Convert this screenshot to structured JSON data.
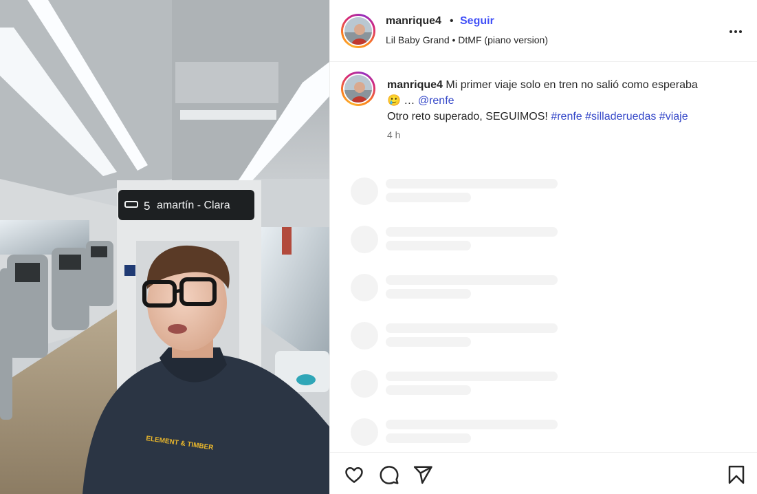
{
  "post": {
    "author": {
      "username": "manrique4",
      "separator": "•",
      "follow_label": "Seguir"
    },
    "audio": {
      "artist": "Lil Baby Grand",
      "separator": "•",
      "track": "DtMF (piano version)"
    },
    "media": {
      "train_sign_number": "5",
      "train_sign_text": "amartín - Clara",
      "hoodie_print": "ELEMENT & TIMBER"
    },
    "caption": {
      "username": "manrique4",
      "text_line1": "Mi primer viaje solo en tren no salió como esperaba",
      "emoji": "🥲",
      "ellipsis": "…",
      "mention": "@renfe",
      "text_line2": "Otro reto superado, SEGUIMOS!",
      "hashtags": [
        "#renfe",
        "#silladeruedas",
        "#viaje"
      ],
      "time": "4 h"
    },
    "loading_comments": 6
  },
  "icons": {
    "more": "more-horizontal-icon",
    "like": "heart-icon",
    "comment": "comment-icon",
    "share": "paper-plane-icon",
    "save": "bookmark-icon"
  },
  "colors": {
    "link_blue": "#4150f7",
    "hashtag_blue": "#3447c8",
    "text": "#262626",
    "muted": "#737373",
    "skeleton": "#f3f3f3",
    "divider": "#efefef"
  }
}
